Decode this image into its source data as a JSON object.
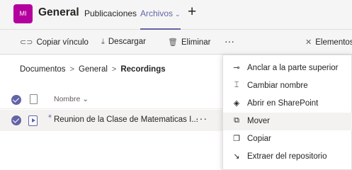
{
  "header": {
    "team_initials": "MI",
    "team_name": "General",
    "tabs": [
      {
        "label": "Publicaciones"
      },
      {
        "label": "Archivos"
      }
    ],
    "add_tab_symbol": "+"
  },
  "toolbar": {
    "copy_link": "Copiar vínculo",
    "download": "Descargar",
    "delete": "Eliminar",
    "more": "···",
    "elements": "Elementos"
  },
  "breadcrumb": {
    "items": [
      "Documentos",
      "General",
      "Recordings"
    ]
  },
  "list": {
    "column_name": "Nombre",
    "rows": [
      {
        "name": "Reunion de la Clase de Matematicas I...",
        "more": "···"
      }
    ]
  },
  "context_menu": {
    "items": [
      {
        "label": "Anclar a la parte superior",
        "icon": "pin-icon"
      },
      {
        "label": "Cambiar nombre",
        "icon": "rename-icon"
      },
      {
        "label": "Abrir en SharePoint",
        "icon": "sharepoint-icon"
      },
      {
        "label": "Mover",
        "icon": "move-icon"
      },
      {
        "label": "Copiar",
        "icon": "copy-icon"
      },
      {
        "label": "Extraer del repositorio",
        "icon": "checkout-icon"
      }
    ]
  },
  "colors": {
    "accent": "#6264a7",
    "team_avatar": "#b4009e"
  }
}
